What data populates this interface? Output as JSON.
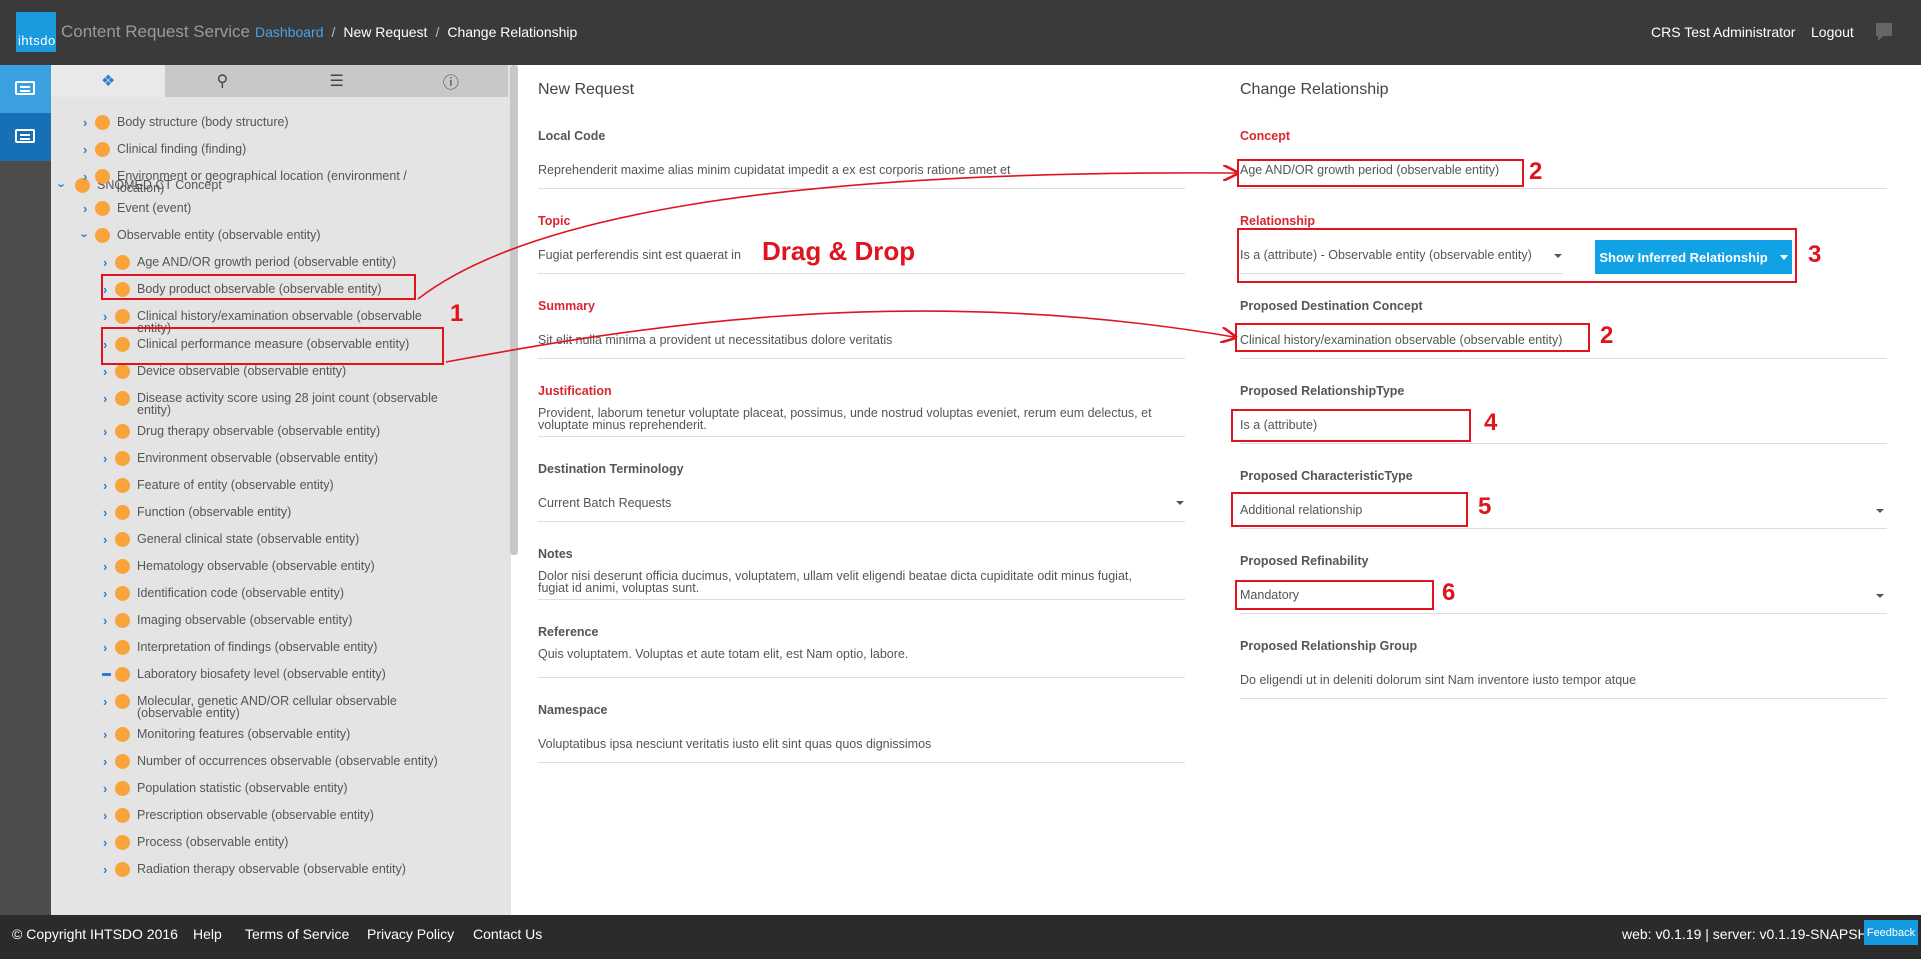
{
  "header": {
    "logo_text": "ihtsdo",
    "app_title": "Content Request Service",
    "breadcrumb": {
      "dashboard": "Dashboard",
      "sep": "/",
      "new_request": "New Request",
      "current": "Change Relationship"
    },
    "user": "CRS Test Administrator",
    "logout": "Logout"
  },
  "tree": {
    "root": "SNOMED CT Concept",
    "items": [
      "Body structure (body structure)",
      "Clinical finding (finding)",
      "Environment or geographical location (environment /",
      "location)",
      "Event (event)",
      "Observable entity (observable entity)",
      "Age AND/OR growth period (observable entity)",
      "Body product observable (observable entity)",
      "Clinical history/examination observable (observable",
      "entity)",
      "Clinical performance measure (observable entity)",
      "Device observable (observable entity)",
      "Disease activity score using 28 joint count (observable",
      "entity)",
      "Drug therapy observable (observable entity)",
      "Environment observable (observable entity)",
      "Feature of entity (observable entity)",
      "Function (observable entity)",
      "General clinical state (observable entity)",
      "Hematology observable (observable entity)",
      "Identification code (observable entity)",
      "Imaging observable (observable entity)",
      "Interpretation of findings (observable entity)",
      "Laboratory biosafety level (observable entity)",
      "Molecular, genetic AND/OR cellular observable",
      "(observable entity)",
      "Monitoring features (observable entity)",
      "Number of occurrences observable (observable entity)",
      "Population statistic (observable entity)",
      "Prescription observable (observable entity)",
      "Process (observable entity)",
      "Radiation therapy observable (observable entity)"
    ]
  },
  "new_request": {
    "title": "New Request",
    "local_code": {
      "label": "Local Code",
      "value": "Reprehenderit maxime alias minim cupidatat impedit a ex est corporis ratione amet et"
    },
    "topic": {
      "label": "Topic",
      "value": "Fugiat perferendis sint est quaerat in"
    },
    "summary": {
      "label": "Summary",
      "value": "Sit elit nulla minima a provident ut necessitatibus dolore veritatis"
    },
    "justification": {
      "label": "Justification",
      "value_line1": "Provident, laborum tenetur voluptate placeat, possimus, unde nostrud voluptas eveniet, rerum eum delectus, et",
      "value_line2": "voluptate minus reprehenderit."
    },
    "destination": {
      "label": "Destination Terminology",
      "value": "Current Batch Requests"
    },
    "notes": {
      "label": "Notes",
      "value_line1": "Dolor nisi deserunt officia ducimus, voluptatem, ullam velit eligendi beatae dicta cupiditate odit minus fugiat,",
      "value_line2": "fugiat id animi, voluptas sunt."
    },
    "reference": {
      "label": "Reference",
      "value": "Quis voluptatem. Voluptas et aute totam elit, est Nam optio, labore."
    },
    "namespace": {
      "label": "Namespace",
      "value": "Voluptatibus ipsa nesciunt veritatis iusto elit sint quas quos dignissimos"
    }
  },
  "change_relationship": {
    "title": "Change Relationship",
    "concept": {
      "label": "Concept",
      "value": "Age AND/OR growth period (observable entity)"
    },
    "relationship": {
      "label": "Relationship",
      "value": "Is a (attribute) - Observable entity (observable entity)"
    },
    "show_inferred": "Show Inferred Relationship",
    "dest_concept": {
      "label": "Proposed Destination Concept",
      "value": "Clinical history/examination observable (observable entity)"
    },
    "rel_type": {
      "label": "Proposed RelationshipType",
      "value": "Is a (attribute)"
    },
    "char_type": {
      "label": "Proposed CharacteristicType",
      "value": "Additional relationship"
    },
    "refinability": {
      "label": "Proposed Refinability",
      "value": "Mandatory"
    },
    "rel_group": {
      "label": "Proposed Relationship Group",
      "value": "Do eligendi ut in deleniti dolorum sint Nam inventore iusto tempor atque"
    }
  },
  "annotations": {
    "drag_drop": "Drag & Drop",
    "n1": "1",
    "n2a": "2",
    "n2b": "2",
    "n3": "3",
    "n4": "4",
    "n5": "5",
    "n6": "6"
  },
  "footer": {
    "copyright": "© Copyright IHTSDO 2016",
    "help": "Help",
    "terms": "Terms of Service",
    "privacy": "Privacy Policy",
    "contact": "Contact Us",
    "version": "web: v0.1.19 | server: v0.1.19-SNAPSHOT",
    "feedback": "Feedback"
  },
  "colors": {
    "accent": "#11a2e6",
    "annotation": "#e0141e",
    "node": "#f9a43a",
    "required": "#d7282f"
  }
}
